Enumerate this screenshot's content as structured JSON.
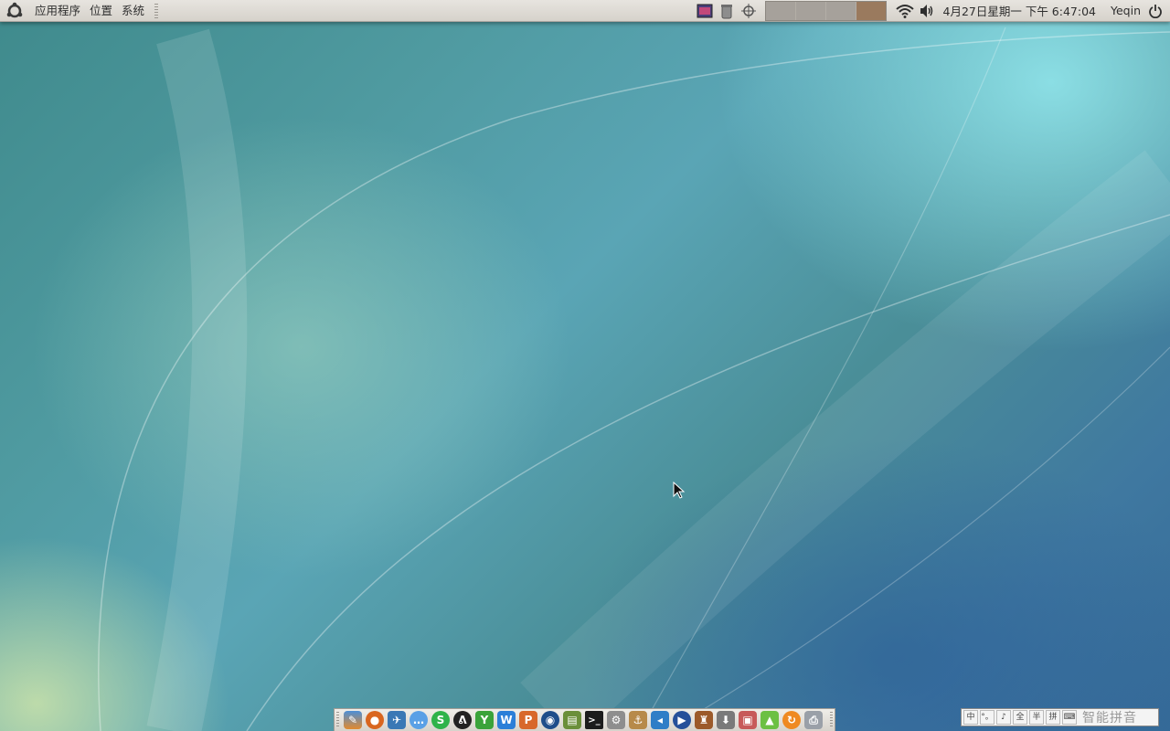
{
  "top_panel": {
    "menus": [
      "应用程序",
      "位置",
      "系统"
    ],
    "clock": "4月27日星期一 下午 6:47:04",
    "user": "Yeqin",
    "tray_icons": [
      "screenshot-icon",
      "trash-applet-icon",
      "crosshair-icon",
      "wifi-icon",
      "volume-icon",
      "power-icon"
    ],
    "workspaces": [
      "workspace-1",
      "workspace-2",
      "workspace-3",
      "workspace-4"
    ],
    "active_workspace": 4
  },
  "dock": {
    "launchers": [
      "compose-icon",
      "basketball-icon",
      "airplane-icon",
      "chat-bubble-icon",
      "skype-icon",
      "qq-penguin-icon",
      "ytop-icon",
      "writer-icon",
      "presentation-icon",
      "disk-icon",
      "book-icon",
      "terminal-icon",
      "settings-icon",
      "ship-icon",
      "vscode-icon",
      "media-player-icon",
      "wine-icon",
      "download-icon",
      "photo-icon",
      "cone-icon",
      "update-icon",
      "printer-icon"
    ]
  },
  "ime_bar": {
    "buttons": [
      "中",
      "°。",
      "♪",
      "全",
      "半",
      "拼",
      "⌨"
    ],
    "label": "智能拼音"
  },
  "colors": {
    "panel_bg": "#dcd8d2",
    "workspace_inactive": "#a6a19b",
    "workspace_active": "#9a7a5e"
  }
}
